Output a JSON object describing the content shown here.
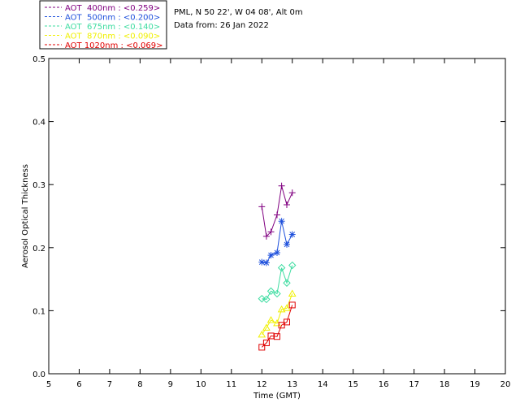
{
  "info": {
    "line1": "PML, N 50 22', W 04 08', Alt 0m",
    "line2": "Data from: 26 Jan 2022"
  },
  "chart_data": {
    "type": "line",
    "xlabel": "Time (GMT)",
    "ylabel": "Aerosol Optical Thickness",
    "xlim": [
      5,
      20
    ],
    "ylim": [
      0.0,
      0.5
    ],
    "xticks": [
      "5",
      "6",
      "7",
      "8",
      "9",
      "10",
      "11",
      "12",
      "13",
      "14",
      "15",
      "16",
      "17",
      "18",
      "19",
      "20"
    ],
    "yticks": [
      "0.0",
      "0.1",
      "0.2",
      "0.3",
      "0.4",
      "0.5"
    ],
    "legend_position": "top-left",
    "grid": false,
    "x": [
      12.0,
      12.15,
      12.3,
      12.5,
      12.65,
      12.82,
      13.0
    ],
    "series": [
      {
        "name": "AOT  400nm : <0.259>",
        "color": "#800080",
        "marker": "plus",
        "values": [
          0.265,
          0.218,
          0.225,
          0.252,
          0.298,
          0.268,
          0.287
        ]
      },
      {
        "name": "AOT  500nm : <0.200>",
        "color": "#1e50dc",
        "marker": "asterisk",
        "values": [
          0.177,
          0.176,
          0.188,
          0.192,
          0.242,
          0.205,
          0.221
        ]
      },
      {
        "name": "AOT  675nm : <0.140>",
        "color": "#3cdca0",
        "marker": "diamond",
        "values": [
          0.119,
          0.118,
          0.131,
          0.127,
          0.168,
          0.144,
          0.172
        ]
      },
      {
        "name": "AOT  870nm : <0.090>",
        "color": "#f0f000",
        "marker": "triangle",
        "values": [
          0.062,
          0.073,
          0.085,
          0.08,
          0.102,
          0.104,
          0.127
        ]
      },
      {
        "name": "AOT 1020nm : <0.069>",
        "color": "#e00000",
        "marker": "square",
        "values": [
          0.042,
          0.049,
          0.06,
          0.059,
          0.077,
          0.082,
          0.109
        ]
      }
    ]
  }
}
